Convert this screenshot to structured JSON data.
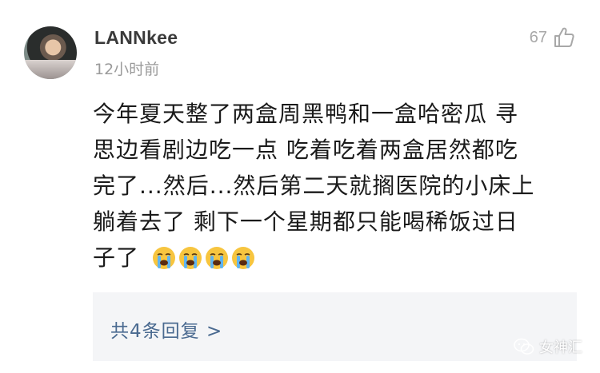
{
  "comment": {
    "username": "LANNkee",
    "timestamp": "12小时前",
    "like_count": "67",
    "text_lines": [
      "今年夏天整了两盒周黑鸭和一盒哈密瓜 寻",
      "思边看剧边吃一点 吃着吃着两盒居然都吃",
      "完了...然后...然后第二天就搁医院的小床上",
      "躺着去了 剩下一个星期都只能喝稀饭过日",
      "子了"
    ],
    "emojis": [
      "crying-face-emoji",
      "crying-face-emoji",
      "crying-face-emoji",
      "crying-face-emoji"
    ]
  },
  "replies": {
    "label": "共4条回复 >"
  },
  "watermark": {
    "text": "女神汇",
    "icon": "wechat-icon"
  },
  "colors": {
    "link": "#4a6a90",
    "muted": "#9b9b9b",
    "reply_bg": "#f4f5f7"
  }
}
